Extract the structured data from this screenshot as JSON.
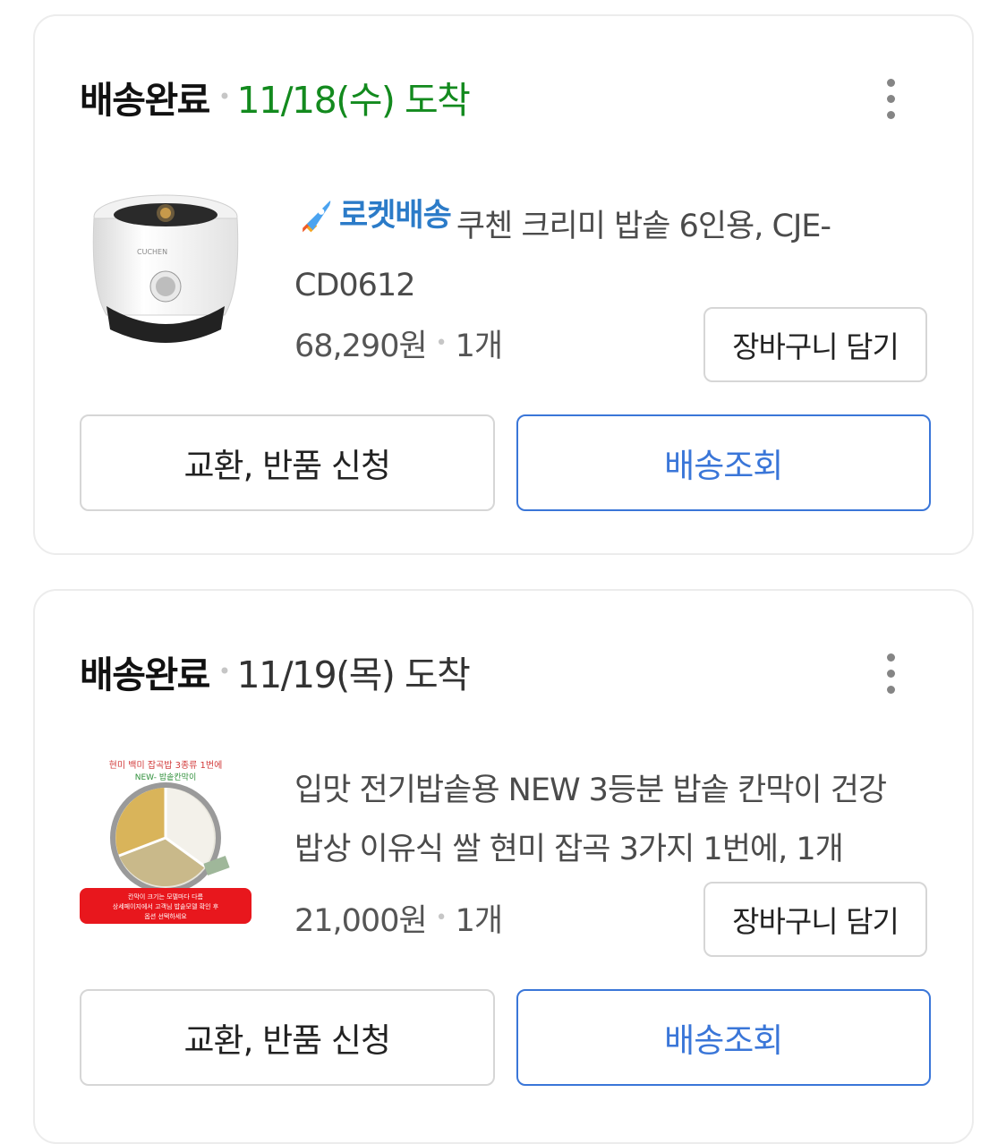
{
  "orders": [
    {
      "status": "배송완료",
      "date": "11/18(수) 도착",
      "date_color": "#138a1e",
      "badge": "로켓배송",
      "badge_icon": "rocket-icon",
      "product_name": "쿠첸 크리미 밥솥 6인용, CJE-CD0612",
      "price": "68,290원",
      "quantity": "1개",
      "cart_button": "장바구니 담기",
      "return_button": "교환, 반품 신청",
      "tracking_button": "배송조회"
    },
    {
      "status": "배송완료",
      "date": "11/19(목) 도착",
      "date_color": "#333333",
      "product_name": "입맛 전기밥솥용 NEW 3등분 밥솥 칸막이 건강 밥상 이유식 쌀 현미 잡곡 3가지 1번에, 1개",
      "image_text": {
        "line1": "현미 백미 잡곡밥 3종류 1번에",
        "line2": "NEW- 밥솥칸막이",
        "footer1": "칸막이 크기는 모델마다 다름",
        "footer2": "상세페이지에서 고객님 밥솥모델 확인 후",
        "footer3": "옵션 선택하세요"
      },
      "price": "21,000원",
      "quantity": "1개",
      "cart_button": "장바구니 담기",
      "return_button": "교환, 반품 신청",
      "tracking_button": "배송조회"
    }
  ]
}
